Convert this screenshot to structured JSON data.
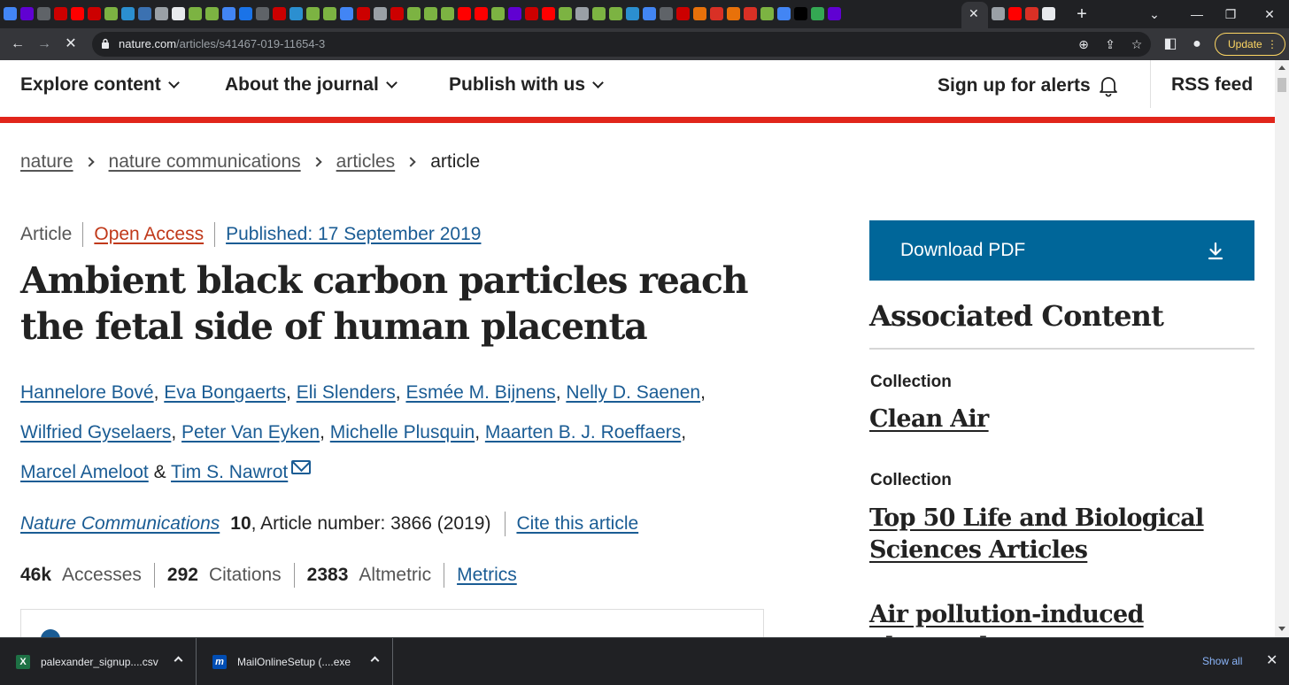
{
  "browser": {
    "tab_favicons": [
      "#4285f4",
      "#6001d2",
      "#5f6368",
      "#cc0000",
      "#ff0000",
      "#cc0000",
      "#7cb342",
      "#2b8fd0",
      "#3b71b1",
      "#9aa0a6",
      "#e8eaed",
      "#7cb342",
      "#7cb342",
      "#4285f4",
      "#1a73e8",
      "#5f6368",
      "#cc0000",
      "#2b8fd0",
      "#7cb342",
      "#7cb342",
      "#4285f4",
      "#cc0000",
      "#9aa0a6",
      "#cc0000",
      "#7cb342",
      "#7cb342",
      "#7cb342",
      "#ff0000",
      "#ff0000",
      "#7cb342",
      "#6001d2",
      "#cc0000",
      "#ff0000",
      "#7cb342",
      "#9aa0a6",
      "#7cb342",
      "#7cb342",
      "#2b8fd0",
      "#4285f4",
      "#5f6368",
      "#cc0000",
      "#e8710a",
      "#d93025",
      "#e8710a",
      "#d93025",
      "#7cb342",
      "#4285f4",
      "#000000",
      "#34a853",
      "#6001d2"
    ],
    "active_tab_close": "✕",
    "after_tab_favicons": [
      "#9aa0a6",
      "#ff0000",
      "#d93025",
      "#e8eaed"
    ],
    "new_tab": "+",
    "window_controls": {
      "tab_search": "⌄",
      "minimize": "—",
      "maximize": "❐",
      "close": "✕"
    },
    "nav": {
      "back": "←",
      "forward": "→",
      "stop": "✕"
    },
    "url_host": "nature.com",
    "url_path": "/articles/s41467-019-11654-3",
    "omni_icons": {
      "zoom": "⊕",
      "share": "⇪",
      "bookmark": "☆"
    },
    "side_panel": "◧",
    "profile": "●",
    "update_label": "Update",
    "menu": "⋮"
  },
  "site_nav": {
    "explore": "Explore content",
    "about": "About the journal",
    "publish": "Publish with us",
    "alerts": "Sign up for alerts",
    "rss": "RSS feed"
  },
  "breadcrumb": {
    "items": [
      "nature",
      "nature communications",
      "articles"
    ],
    "current": "article"
  },
  "article": {
    "type": "Article",
    "access": "Open Access",
    "published": "Published: 17 September 2019",
    "title": "Ambient black carbon particles reach the fetal side of human placenta",
    "authors": [
      "Hannelore Bové",
      "Eva Bongaerts",
      "Eli Slenders",
      "Esmée M. Bijnens",
      "Nelly D. Saenen",
      "Wilfried Gyselaers",
      "Peter Van Eyken",
      "Michelle Plusquin",
      "Maarten B. J. Roeffaers",
      "Marcel Ameloot",
      "Tim S. Nawrot"
    ],
    "author_sep": ", ",
    "author_and": " & ",
    "journal": "Nature Communications",
    "volume": "10",
    "article_number": ", Article number: 3866 (2019)",
    "cite": "Cite this article",
    "metrics": {
      "accesses_num": "46k",
      "accesses_label": "Accesses",
      "citations_num": "292",
      "citations_label": "Citations",
      "altmetric_num": "2383",
      "altmetric_label": "Altmetric",
      "link": "Metrics"
    }
  },
  "sidebar": {
    "download": "Download PDF",
    "associated_heading": "Associated Content",
    "collections": [
      {
        "label": "Collection",
        "title": "Clean Air"
      },
      {
        "label": "Collection",
        "title": "Top 50 Life and Biological Sciences Articles"
      },
      {
        "label": "",
        "title": "Air pollution-induced placental"
      }
    ]
  },
  "downloads": {
    "items": [
      {
        "name": "palexander_signup....csv",
        "icon": "X"
      },
      {
        "name": "MailOnlineSetup (....exe",
        "icon": "m"
      }
    ],
    "show_all": "Show all",
    "close": "✕"
  },
  "colors": {
    "nature_red": "#e1251b",
    "link_blue": "#1a5c94",
    "open_access": "#c0391a",
    "download_button": "#006699",
    "chrome_dark": "#202124",
    "chrome_toolbar": "#35363a"
  }
}
